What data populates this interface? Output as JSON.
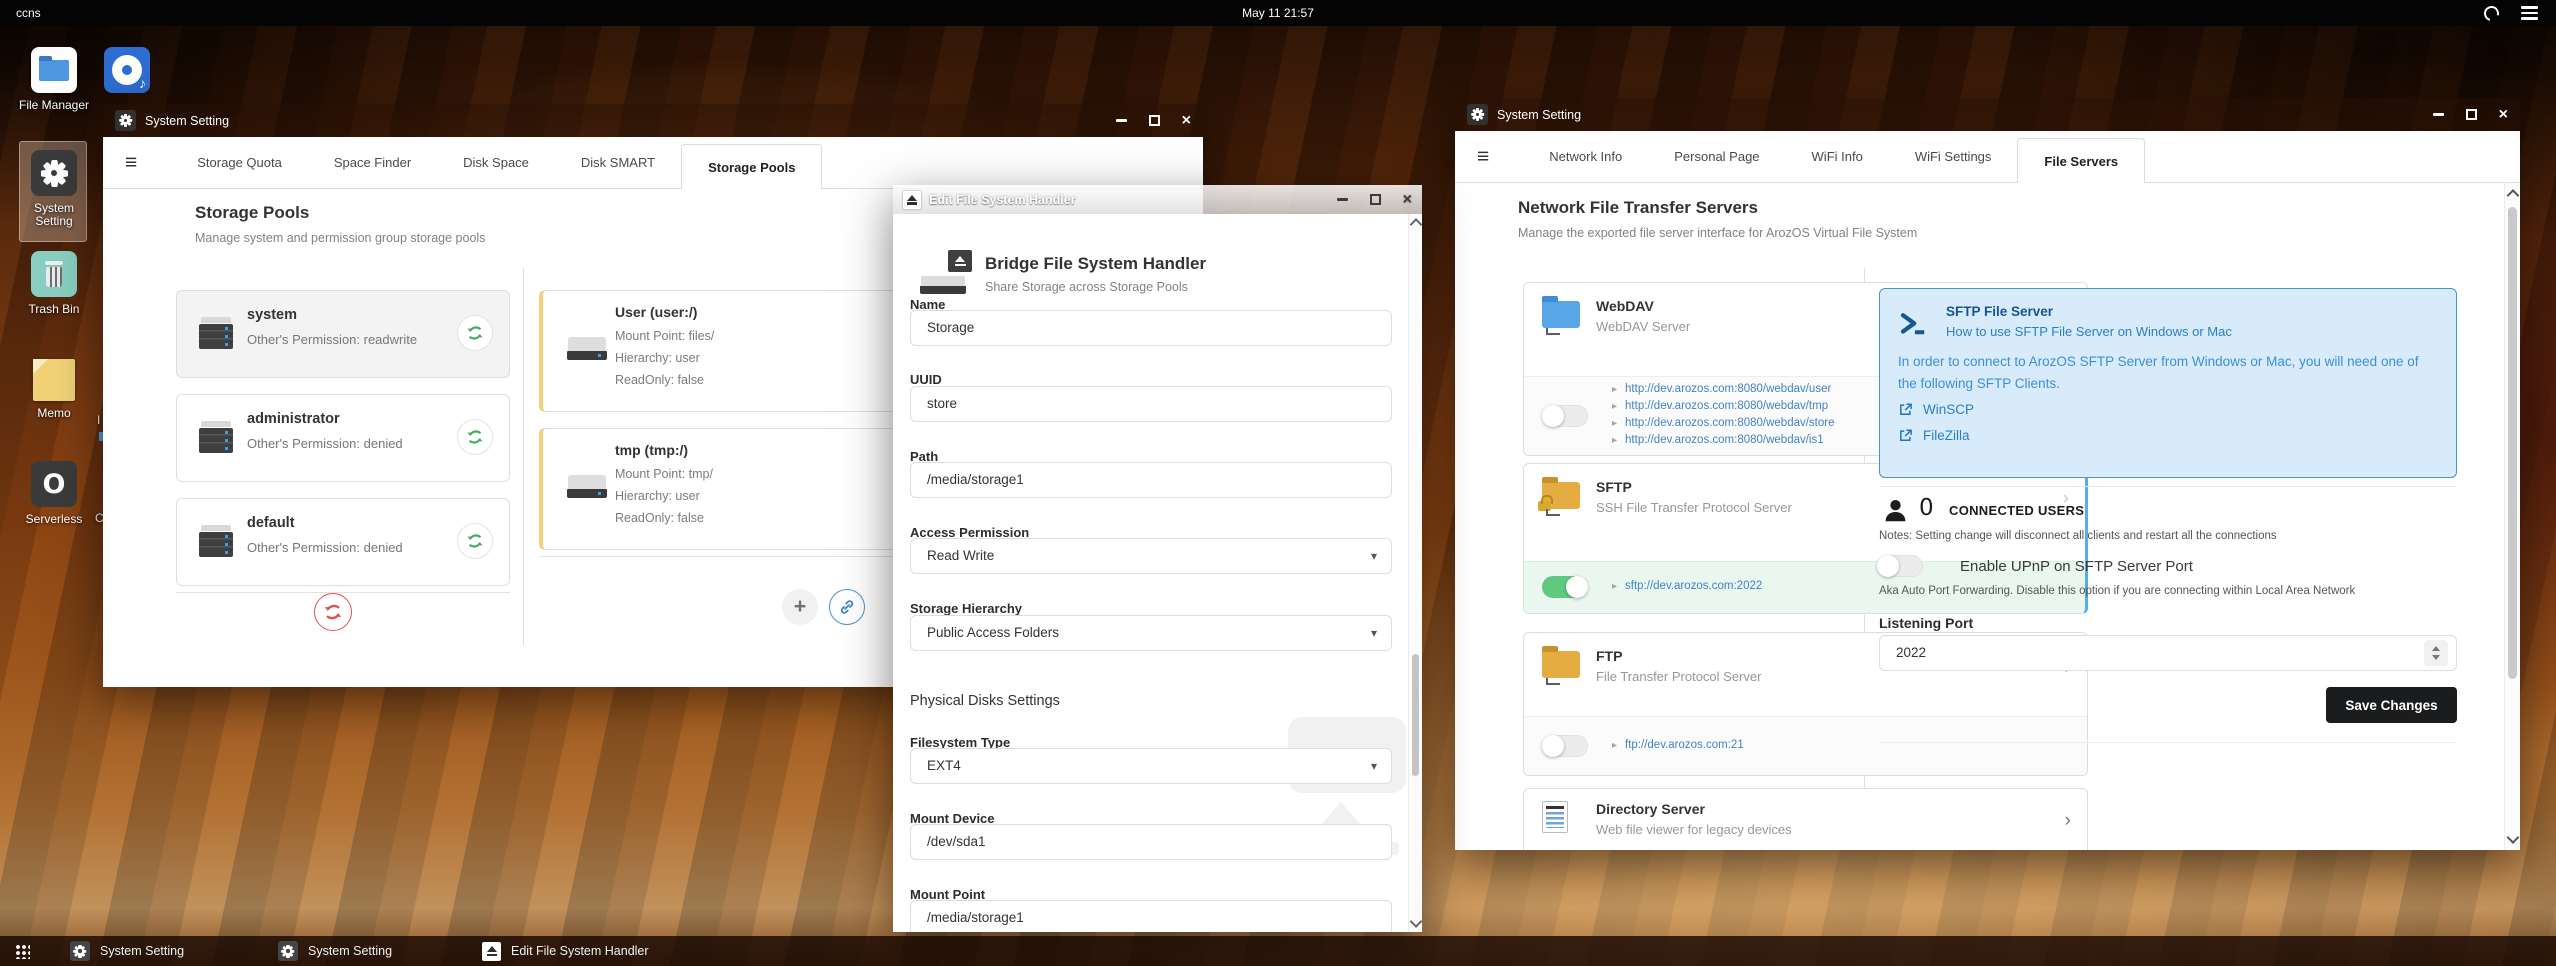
{
  "topbar": {
    "host": "ccns",
    "clock": "May 11 21:57"
  },
  "icons": {
    "close": "×",
    "minimize": "–",
    "caret": "▾",
    "bullet": "▸",
    "chevron": "›",
    "plus": "+",
    "music_note": "♪",
    "hamburger": "≡",
    "serverless_glyph": "O"
  },
  "desktop": {
    "icons": [
      {
        "label": "File Manager"
      },
      {
        "label": "System Setting"
      },
      {
        "label": "Trash Bin"
      },
      {
        "label": "Memo"
      },
      {
        "label": "Serverless"
      }
    ],
    "partial_labels": [
      "I",
      "C"
    ]
  },
  "win1": {
    "title": "System Setting",
    "tabs": [
      {
        "label": "Storage Quota"
      },
      {
        "label": "Space Finder"
      },
      {
        "label": "Disk Space"
      },
      {
        "label": "Disk SMART"
      },
      {
        "label": "Storage Pools"
      }
    ],
    "heading": "Storage Pools",
    "subheading": "Manage system and permission group storage pools",
    "pools": [
      {
        "name": "system",
        "permission": "Other's Permission: readwrite"
      },
      {
        "name": "administrator",
        "permission": "Other's Permission: denied"
      },
      {
        "name": "default",
        "permission": "Other's Permission: denied"
      }
    ],
    "handlers": [
      {
        "name": "User (user:/)",
        "mount": "Mount Point: files/",
        "hierarchy": "Hierarchy: user",
        "readonly": "ReadOnly: false"
      },
      {
        "name": "tmp (tmp:/)",
        "mount": "Mount Point: tmp/",
        "hierarchy": "Hierarchy: user",
        "readonly": "ReadOnly: false"
      }
    ]
  },
  "editwin": {
    "title": "Edit File System Handler",
    "heading": "Bridge File System Handler",
    "subheading": "Share Storage across Storage Pools",
    "section_heading": "Physical Disks Settings",
    "fields": [
      {
        "label": "Name",
        "value": "Storage"
      },
      {
        "label": "UUID",
        "value": "store"
      },
      {
        "label": "Path",
        "value": "/media/storage1"
      },
      {
        "label": "Access Permission",
        "value": "Read Write"
      },
      {
        "label": "Storage Hierarchy",
        "value": "Public Access Folders"
      },
      {
        "label": "Filesystem Type",
        "value": "EXT4"
      },
      {
        "label": "Mount Device",
        "value": "/dev/sda1"
      },
      {
        "label": "Mount Point",
        "value": "/media/storage1"
      }
    ]
  },
  "win2": {
    "title": "System Setting",
    "tabs": [
      {
        "label": "Network Info"
      },
      {
        "label": "Personal Page"
      },
      {
        "label": "WiFi Info"
      },
      {
        "label": "WiFi Settings"
      },
      {
        "label": "File Servers"
      }
    ],
    "heading": "Network File Transfer Servers",
    "subheading": "Manage the exported file server interface for ArozOS Virtual File System",
    "servers": [
      {
        "name": "WebDAV",
        "desc": "WebDAV Server",
        "links": [
          "http://dev.arozos.com:8080/webdav/user",
          "http://dev.arozos.com:8080/webdav/tmp",
          "http://dev.arozos.com:8080/webdav/store",
          "http://dev.arozos.com:8080/webdav/is1"
        ]
      },
      {
        "name": "SFTP",
        "desc": "SSH File Transfer Protocol Server",
        "links": [
          "sftp://dev.arozos.com:2022"
        ]
      },
      {
        "name": "FTP",
        "desc": "File Transfer Protocol Server",
        "links": [
          "ftp://dev.arozos.com:21"
        ]
      },
      {
        "name": "Directory Server",
        "desc": "Web file viewer for legacy devices"
      }
    ],
    "sftp_help": {
      "title": "SFTP File Server",
      "subtitle": "How to use SFTP File Server on Windows or Mac",
      "body": "In order to connect to ArozOS SFTP Server from Windows or Mac, you will need one of the following SFTP Clients.",
      "clients": [
        {
          "label": "WinSCP"
        },
        {
          "label": "FileZilla"
        }
      ]
    },
    "connected_users": {
      "count": "0",
      "label": "CONNECTED USERS",
      "notes": "Notes: Setting change will disconnect all clients and restart all the connections"
    },
    "upnp": {
      "label": "Enable UPnP on SFTP Server Port",
      "desc": "Aka Auto Port Forwarding. Disable this option if you are connecting within Local Area Network"
    },
    "listening_port": {
      "label": "Listening Port",
      "value": "2022"
    },
    "save_label": "Save Changes"
  },
  "taskbar": {
    "items": [
      {
        "label": "System Setting"
      },
      {
        "label": "System Setting"
      },
      {
        "label": "Edit File System Handler"
      }
    ]
  },
  "colors": {
    "accent_blue": "#4183c4",
    "toggle_on": "#5ec97f",
    "save_button": "#1b1c1d",
    "selected_icon_bg": "#2e6ed4",
    "sftp_row_bg": "#eaf7ef",
    "info_box_bg": "#d8ebfb",
    "info_box_border": "#4596d1",
    "handler_accent": "#f1cf7b",
    "refresh_red": "#e05252",
    "sync_green": "#3fae58"
  }
}
